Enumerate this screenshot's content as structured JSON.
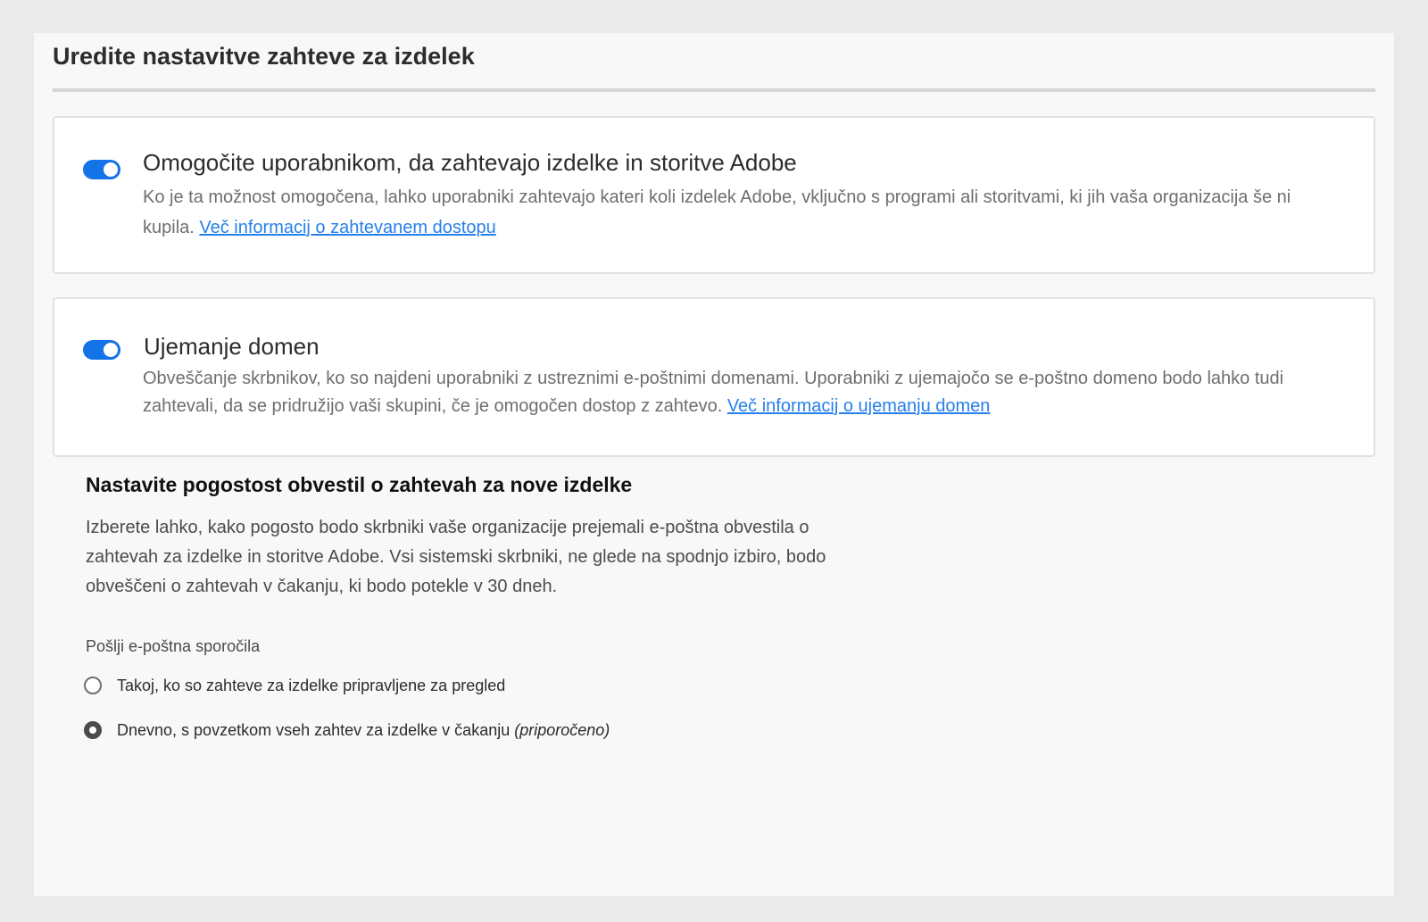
{
  "page": {
    "title": "Uredite nastavitve zahteve za izdelek"
  },
  "request_card": {
    "toggle_on": true,
    "heading": "Omogočite uporabnikom, da zahtevajo izdelke in storitve Adobe",
    "description": "Ko je ta možnost omogočena, lahko uporabniki zahtevajo kateri koli izdelek Adobe, vključno s programi ali storitvami, ki jih vaša organizacija še ni kupila. ",
    "link_text": "Več informacij o zahtevanem dostopu"
  },
  "domain_card": {
    "toggle_on": true,
    "heading": "Ujemanje domen",
    "description": "Obveščanje skrbnikov, ko so najdeni uporabniki z ustreznimi e-poštnimi domenami. Uporabniki z ujemajočo se e-poštno domeno bodo lahko tudi zahtevali, da se pridružijo vaši skupini, če je omogočen dostop z zahtevo. ",
    "link_text": "Več informacij o ujemanju domen"
  },
  "frequency": {
    "heading": "Nastavite pogostost obvestil o zahtevah za nove izdelke",
    "description": "Izberete lahko, kako pogosto bodo skrbniki vaše organizacije prejemali e-poštna obvestila o zahtevah za izdelke in storitve Adobe. Vsi sistemski skrbniki, ne glede na spodnjo izbiro, bodo obveščeni o zahtevah v čakanju, ki bodo potekle v 30 dneh.",
    "group_label": "Pošlji e-poštna sporočila",
    "options": [
      {
        "label": "Takoj, ko so zahteve za izdelke pripravljene za pregled",
        "note": "",
        "selected": false
      },
      {
        "label": "Dnevno, s povzetkom vseh zahtev za izdelke  v čakanju ",
        "note": "(priporočeno)",
        "selected": true
      }
    ]
  },
  "colors": {
    "accent": "#1473e6",
    "link": "#2680eb",
    "panel_background": "#f8f8f8",
    "page_background": "#eaeaea"
  }
}
